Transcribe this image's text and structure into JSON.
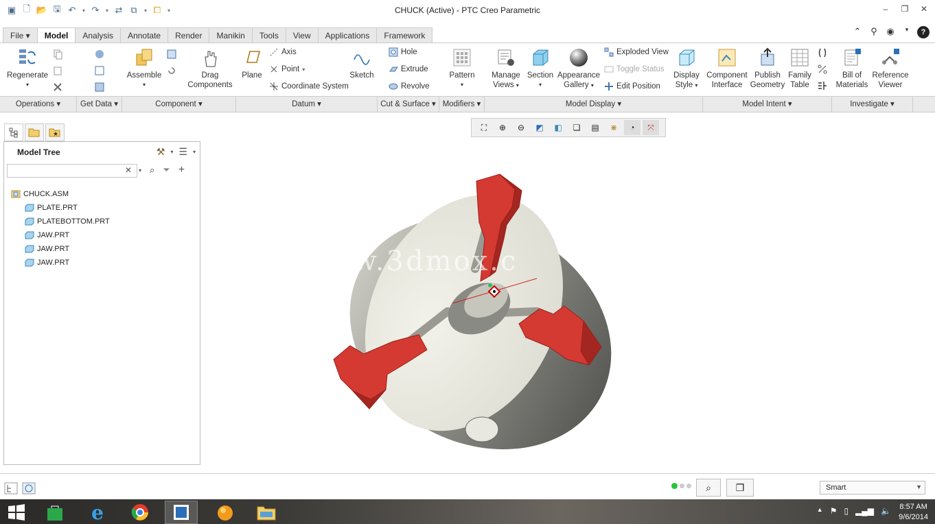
{
  "window": {
    "title": "CHUCK (Active) - PTC Creo Parametric"
  },
  "tabs": [
    "File",
    "Model",
    "Analysis",
    "Annotate",
    "Render",
    "Manikin",
    "Tools",
    "View",
    "Applications",
    "Framework"
  ],
  "ribbon": {
    "regenerate": "Regenerate",
    "assemble": "Assemble",
    "drag_components_1": "Drag",
    "drag_components_2": "Components",
    "plane": "Plane",
    "axis": "Axis",
    "point": "Point",
    "coord_system": "Coordinate System",
    "sketch": "Sketch",
    "hole": "Hole",
    "extrude": "Extrude",
    "revolve": "Revolve",
    "pattern": "Pattern",
    "manage_views_1": "Manage",
    "manage_views_2": "Views",
    "section": "Section",
    "appearance_1": "Appearance",
    "appearance_2": "Gallery",
    "exploded_view": "Exploded View",
    "toggle_status": "Toggle Status",
    "edit_position": "Edit Position",
    "display_style_1": "Display",
    "display_style_2": "Style",
    "component_interface_1": "Component",
    "component_interface_2": "Interface",
    "publish_geometry_1": "Publish",
    "publish_geometry_2": "Geometry",
    "family_table_1": "Family",
    "family_table_2": "Table",
    "bom_1": "Bill of",
    "bom_2": "Materials",
    "ref_viewer_1": "Reference",
    "ref_viewer_2": "Viewer"
  },
  "groups": [
    "Operations",
    "Get Data",
    "Component",
    "Datum",
    "Cut & Surface",
    "Modifiers",
    "Model Display",
    "Model Intent",
    "Investigate"
  ],
  "model_tree": {
    "title": "Model Tree",
    "search_value": "",
    "items": [
      "CHUCK.ASM",
      "PLATE.PRT",
      "PLATEBOTTOM.PRT",
      "JAW.PRT",
      "JAW.PRT",
      "JAW.PRT"
    ]
  },
  "viewport": {
    "watermark": "www.3dmox.c"
  },
  "status": {
    "selection_filter": "Smart"
  },
  "taskbar": {
    "time": "8:57 AM",
    "date": "9/6/2014"
  },
  "colors": {
    "jaw_red": "#d43a32",
    "body_gray": "#e2e2da",
    "accent_blue": "#2a6fb8"
  }
}
